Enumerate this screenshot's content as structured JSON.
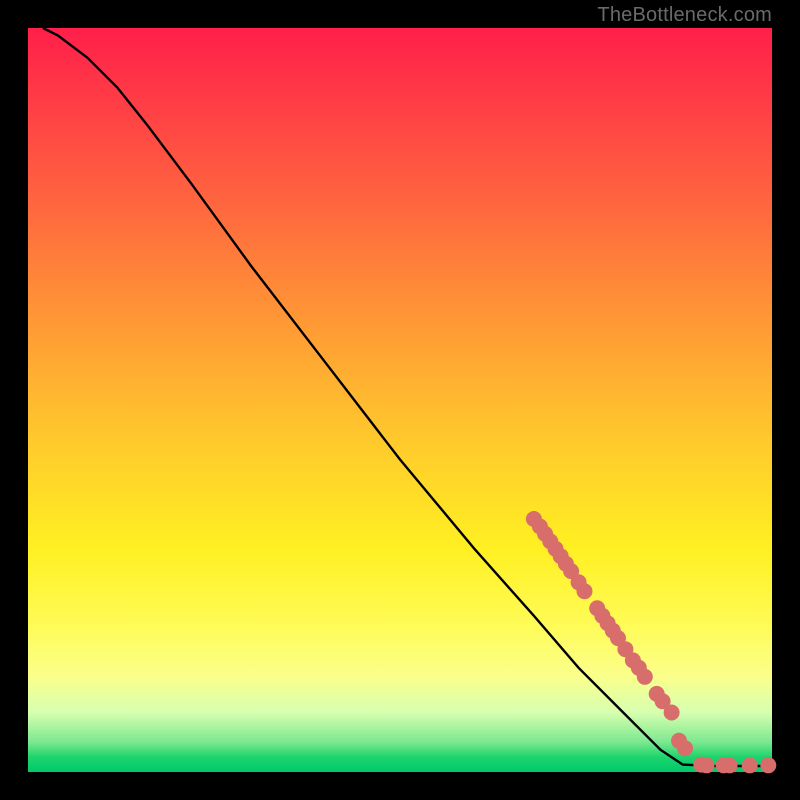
{
  "attribution": "TheBottleneck.com",
  "colors": {
    "background": "#000000",
    "curve": "#000000",
    "marker": "#d86e6b",
    "gradient_top": "#ff1f4a",
    "gradient_mid": "#fff022",
    "gradient_bottom": "#00c96b"
  },
  "chart_data": {
    "type": "line",
    "title": "",
    "xlabel": "",
    "ylabel": "",
    "xlim": [
      0,
      100
    ],
    "ylim": [
      0,
      100
    ],
    "curve": [
      {
        "x": 2,
        "y": 100
      },
      {
        "x": 4,
        "y": 99
      },
      {
        "x": 8,
        "y": 96
      },
      {
        "x": 12,
        "y": 92
      },
      {
        "x": 16,
        "y": 87
      },
      {
        "x": 22,
        "y": 79
      },
      {
        "x": 30,
        "y": 68
      },
      {
        "x": 40,
        "y": 55
      },
      {
        "x": 50,
        "y": 42
      },
      {
        "x": 60,
        "y": 30
      },
      {
        "x": 68,
        "y": 21
      },
      {
        "x": 74,
        "y": 14
      },
      {
        "x": 80,
        "y": 8
      },
      {
        "x": 85,
        "y": 3
      },
      {
        "x": 88,
        "y": 1
      },
      {
        "x": 92,
        "y": 0.8
      },
      {
        "x": 96,
        "y": 0.8
      },
      {
        "x": 100,
        "y": 0.8
      }
    ],
    "markers": [
      {
        "x": 68.0,
        "y": 34.0
      },
      {
        "x": 68.8,
        "y": 33.0
      },
      {
        "x": 69.5,
        "y": 32.0
      },
      {
        "x": 70.2,
        "y": 31.0
      },
      {
        "x": 70.9,
        "y": 30.0
      },
      {
        "x": 71.6,
        "y": 29.0
      },
      {
        "x": 72.3,
        "y": 28.0
      },
      {
        "x": 73.0,
        "y": 27.0
      },
      {
        "x": 74.0,
        "y": 25.5
      },
      {
        "x": 74.8,
        "y": 24.3
      },
      {
        "x": 76.5,
        "y": 22.0
      },
      {
        "x": 77.2,
        "y": 21.0
      },
      {
        "x": 77.9,
        "y": 20.0
      },
      {
        "x": 78.6,
        "y": 19.0
      },
      {
        "x": 79.3,
        "y": 18.0
      },
      {
        "x": 80.3,
        "y": 16.5
      },
      {
        "x": 81.3,
        "y": 15.0
      },
      {
        "x": 82.1,
        "y": 14.0
      },
      {
        "x": 82.9,
        "y": 12.8
      },
      {
        "x": 84.5,
        "y": 10.5
      },
      {
        "x": 85.3,
        "y": 9.5
      },
      {
        "x": 86.5,
        "y": 8.0
      },
      {
        "x": 87.5,
        "y": 4.2
      },
      {
        "x": 88.3,
        "y": 3.2
      },
      {
        "x": 90.5,
        "y": 1.0
      },
      {
        "x": 91.2,
        "y": 0.9
      },
      {
        "x": 93.5,
        "y": 0.9
      },
      {
        "x": 94.3,
        "y": 0.9
      },
      {
        "x": 97.0,
        "y": 0.9
      },
      {
        "x": 99.5,
        "y": 0.9
      }
    ],
    "marker_radius_px": 8
  }
}
